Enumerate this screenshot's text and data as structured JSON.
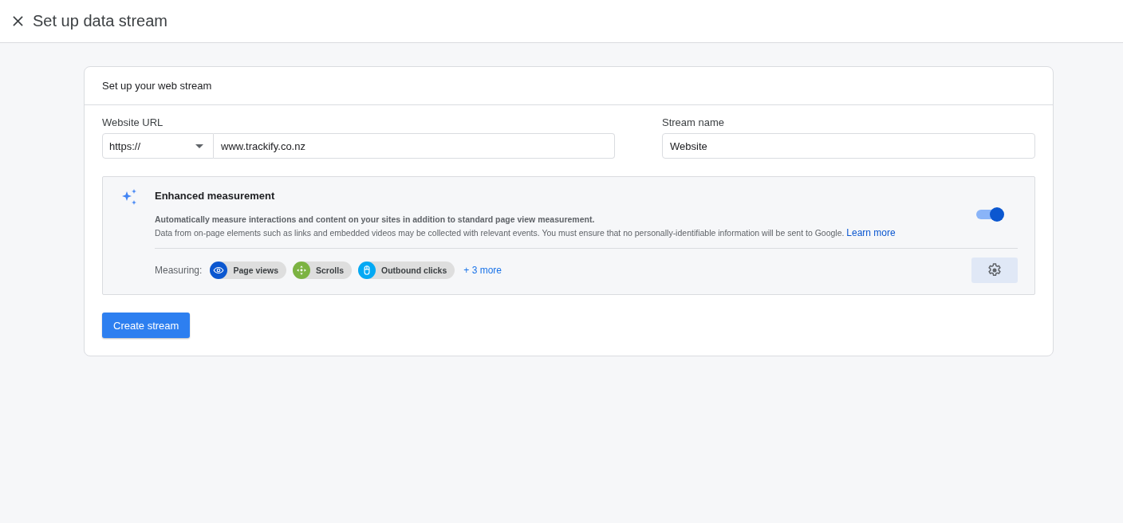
{
  "header": {
    "title": "Set up data stream"
  },
  "card": {
    "title": "Set up your web stream",
    "website_url": {
      "label": "Website URL",
      "protocol": "https://",
      "value": "www.trackify.co.nz"
    },
    "stream_name": {
      "label": "Stream name",
      "value": "Website"
    },
    "enhanced_measurement": {
      "title": "Enhanced measurement",
      "on": true,
      "description": "Automatically measure interactions and content on your sites in addition to standard page view measurement.",
      "note": "Data from on-page elements such as links and embedded videos may be collected with relevant events. You must ensure that no personally-identifiable information will be sent to Google.",
      "link": "Learn more",
      "measuring_label": "Measuring:",
      "chips": [
        {
          "label": "Page views",
          "kind": "eye",
          "color": "#0b57d0"
        },
        {
          "label": "Scrolls",
          "kind": "scroll",
          "color": "#7cb342"
        },
        {
          "label": "Outbound clicks",
          "kind": "mouse",
          "color": "#03a9f4"
        }
      ],
      "more": "+ 3 more"
    },
    "button": "Create stream"
  }
}
